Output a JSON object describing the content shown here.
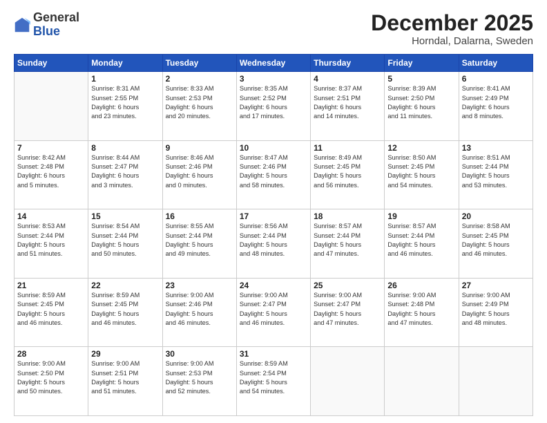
{
  "logo": {
    "general": "General",
    "blue": "Blue"
  },
  "header": {
    "month": "December 2025",
    "location": "Horndal, Dalarna, Sweden"
  },
  "weekdays": [
    "Sunday",
    "Monday",
    "Tuesday",
    "Wednesday",
    "Thursday",
    "Friday",
    "Saturday"
  ],
  "weeks": [
    [
      {
        "day": "",
        "info": ""
      },
      {
        "day": "1",
        "info": "Sunrise: 8:31 AM\nSunset: 2:55 PM\nDaylight: 6 hours\nand 23 minutes."
      },
      {
        "day": "2",
        "info": "Sunrise: 8:33 AM\nSunset: 2:53 PM\nDaylight: 6 hours\nand 20 minutes."
      },
      {
        "day": "3",
        "info": "Sunrise: 8:35 AM\nSunset: 2:52 PM\nDaylight: 6 hours\nand 17 minutes."
      },
      {
        "day": "4",
        "info": "Sunrise: 8:37 AM\nSunset: 2:51 PM\nDaylight: 6 hours\nand 14 minutes."
      },
      {
        "day": "5",
        "info": "Sunrise: 8:39 AM\nSunset: 2:50 PM\nDaylight: 6 hours\nand 11 minutes."
      },
      {
        "day": "6",
        "info": "Sunrise: 8:41 AM\nSunset: 2:49 PM\nDaylight: 6 hours\nand 8 minutes."
      }
    ],
    [
      {
        "day": "7",
        "info": "Sunrise: 8:42 AM\nSunset: 2:48 PM\nDaylight: 6 hours\nand 5 minutes."
      },
      {
        "day": "8",
        "info": "Sunrise: 8:44 AM\nSunset: 2:47 PM\nDaylight: 6 hours\nand 3 minutes."
      },
      {
        "day": "9",
        "info": "Sunrise: 8:46 AM\nSunset: 2:46 PM\nDaylight: 6 hours\nand 0 minutes."
      },
      {
        "day": "10",
        "info": "Sunrise: 8:47 AM\nSunset: 2:46 PM\nDaylight: 5 hours\nand 58 minutes."
      },
      {
        "day": "11",
        "info": "Sunrise: 8:49 AM\nSunset: 2:45 PM\nDaylight: 5 hours\nand 56 minutes."
      },
      {
        "day": "12",
        "info": "Sunrise: 8:50 AM\nSunset: 2:45 PM\nDaylight: 5 hours\nand 54 minutes."
      },
      {
        "day": "13",
        "info": "Sunrise: 8:51 AM\nSunset: 2:44 PM\nDaylight: 5 hours\nand 53 minutes."
      }
    ],
    [
      {
        "day": "14",
        "info": "Sunrise: 8:53 AM\nSunset: 2:44 PM\nDaylight: 5 hours\nand 51 minutes."
      },
      {
        "day": "15",
        "info": "Sunrise: 8:54 AM\nSunset: 2:44 PM\nDaylight: 5 hours\nand 50 minutes."
      },
      {
        "day": "16",
        "info": "Sunrise: 8:55 AM\nSunset: 2:44 PM\nDaylight: 5 hours\nand 49 minutes."
      },
      {
        "day": "17",
        "info": "Sunrise: 8:56 AM\nSunset: 2:44 PM\nDaylight: 5 hours\nand 48 minutes."
      },
      {
        "day": "18",
        "info": "Sunrise: 8:57 AM\nSunset: 2:44 PM\nDaylight: 5 hours\nand 47 minutes."
      },
      {
        "day": "19",
        "info": "Sunrise: 8:57 AM\nSunset: 2:44 PM\nDaylight: 5 hours\nand 46 minutes."
      },
      {
        "day": "20",
        "info": "Sunrise: 8:58 AM\nSunset: 2:45 PM\nDaylight: 5 hours\nand 46 minutes."
      }
    ],
    [
      {
        "day": "21",
        "info": "Sunrise: 8:59 AM\nSunset: 2:45 PM\nDaylight: 5 hours\nand 46 minutes."
      },
      {
        "day": "22",
        "info": "Sunrise: 8:59 AM\nSunset: 2:45 PM\nDaylight: 5 hours\nand 46 minutes."
      },
      {
        "day": "23",
        "info": "Sunrise: 9:00 AM\nSunset: 2:46 PM\nDaylight: 5 hours\nand 46 minutes."
      },
      {
        "day": "24",
        "info": "Sunrise: 9:00 AM\nSunset: 2:47 PM\nDaylight: 5 hours\nand 46 minutes."
      },
      {
        "day": "25",
        "info": "Sunrise: 9:00 AM\nSunset: 2:47 PM\nDaylight: 5 hours\nand 47 minutes."
      },
      {
        "day": "26",
        "info": "Sunrise: 9:00 AM\nSunset: 2:48 PM\nDaylight: 5 hours\nand 47 minutes."
      },
      {
        "day": "27",
        "info": "Sunrise: 9:00 AM\nSunset: 2:49 PM\nDaylight: 5 hours\nand 48 minutes."
      }
    ],
    [
      {
        "day": "28",
        "info": "Sunrise: 9:00 AM\nSunset: 2:50 PM\nDaylight: 5 hours\nand 50 minutes."
      },
      {
        "day": "29",
        "info": "Sunrise: 9:00 AM\nSunset: 2:51 PM\nDaylight: 5 hours\nand 51 minutes."
      },
      {
        "day": "30",
        "info": "Sunrise: 9:00 AM\nSunset: 2:53 PM\nDaylight: 5 hours\nand 52 minutes."
      },
      {
        "day": "31",
        "info": "Sunrise: 8:59 AM\nSunset: 2:54 PM\nDaylight: 5 hours\nand 54 minutes."
      },
      {
        "day": "",
        "info": ""
      },
      {
        "day": "",
        "info": ""
      },
      {
        "day": "",
        "info": ""
      }
    ]
  ]
}
